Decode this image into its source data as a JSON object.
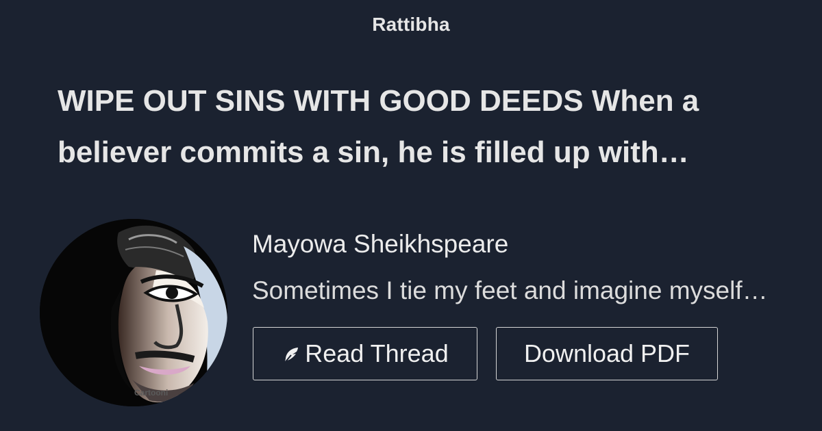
{
  "header": {
    "brand": "Rattibha"
  },
  "thread": {
    "title": "WIPE OUT SINS WITH GOOD DEEDS When a\nbeliever commits a sin, he is filled up with…"
  },
  "author": {
    "name": "Mayowa Sheikhspeare",
    "bio": "Sometimes I tie my feet and imagine myself…",
    "avatar_watermark": "Cartooni"
  },
  "actions": {
    "read_label": "Read Thread",
    "read_icon": "feather-icon",
    "pdf_label": "Download PDF"
  },
  "colors": {
    "background": "#1b2230",
    "text": "#e6e6e6",
    "button_border": "#d6d6d6"
  }
}
